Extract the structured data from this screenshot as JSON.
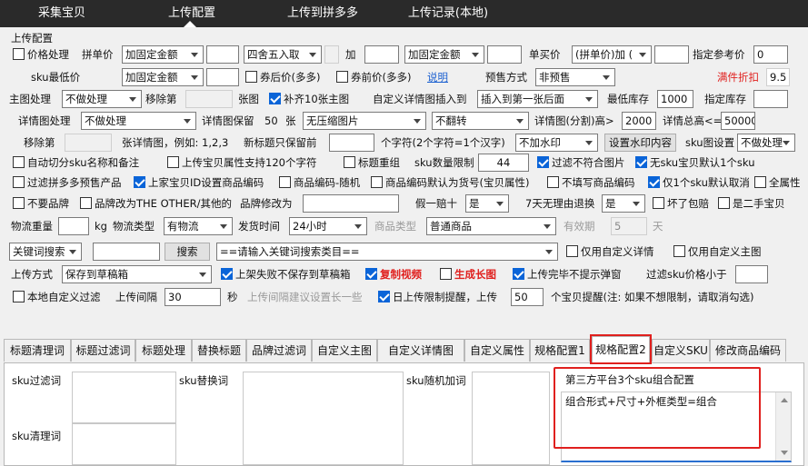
{
  "nav": {
    "tabs": [
      "采集宝贝",
      "上传配置",
      "上传到拼多多",
      "上传记录(本地)"
    ],
    "active_index": 1
  },
  "form": {
    "group_title": "上传配置",
    "r1": {
      "price_cb": "价格处理",
      "pin_label": "拼单价",
      "pin_sel": "加固定金额",
      "pin_amount": "",
      "pin_round_sel": "四舍五入取",
      "plus": "加",
      "pin_add": "",
      "single_sel": "加固定金额",
      "single_add": "",
      "buy_label": "单买价",
      "buy_sel": "(拼单价)加 (",
      "buy_add": "",
      "ref_label": "指定参考价",
      "ref_value": "0"
    },
    "r2": {
      "sku_min_label": "sku最低价",
      "sku_min_sel": "加固定金额",
      "sku_min_val": "",
      "after_coupon": "券后价(多多)",
      "before_coupon": "券前价(多多)",
      "explain": "说明",
      "presale_label": "预售方式",
      "presale_sel": "非预售",
      "discount_label": "满件折扣",
      "discount_value": "9.5"
    },
    "r3": {
      "main_img_label": "主图处理",
      "main_img_sel": "不做处理",
      "remove_label": "移除第",
      "remove_val": "",
      "img_unit": "张图",
      "fill10": "补齐10张主图",
      "custom_detail_label": "自定义详情图插入到",
      "custom_detail_sel": "插入到第一张后面",
      "min_stock_label": "最低库存",
      "min_stock": "1000",
      "spec_stock_label": "指定库存",
      "spec_stock": ""
    },
    "r4": {
      "detail_label": "详情图处理",
      "detail_sel": "不做处理",
      "keep_label": "详情图保留",
      "keep_value": "50",
      "keep_unit": "张",
      "compress_sel": "无压缩图片",
      "flip_sel": "不翻转",
      "split_label": "详情图(分割)高>",
      "split_value": "2000",
      "total_label": "详情总高<=",
      "total_value": "50000"
    },
    "r5": {
      "remove_label": "移除第",
      "remove_val": "",
      "remove_hint": "张详情图，例如: 1,2,3",
      "title_keep_label": "新标题只保留前",
      "title_keep_val": "",
      "title_keep_hint": "个字符(2个字符=1个汉字)",
      "watermark_sel": "不加水印",
      "watermark_btn": "设置水印内容",
      "skuimg_label": "sku图设置",
      "skuimg_sel": "不做处理"
    },
    "r6": {
      "auto_split": "自动切分sku名称和备注",
      "support120": "上传宝贝属性支持120个字符",
      "title_reorg": "标题重组",
      "sku_limit_label": "sku数量限制",
      "sku_limit_val": "44",
      "filter_img": "过滤不符合图片",
      "no_sku_default": "无sku宝贝默认1个sku"
    },
    "r7": {
      "filter_presale": "过滤拼多多预售产品",
      "upload_id": "上家宝贝ID设置商品编码",
      "code_random": "商品编码-随机",
      "code_default": "商品编码默认为货号(宝贝属性)",
      "no_code": "不填写商品编码",
      "one_sku_cancel": "仅1个sku默认取消",
      "all_attrs": "全属性"
    },
    "r8": {
      "no_brand": "不要品牌",
      "brand_other": "品牌改为THE OTHER/其他的",
      "brand_change_label": "品牌修改为",
      "brand_change_val": "",
      "fake_label": "假一赔十",
      "fake_sel": "是",
      "seven_label": "7天无理由退换",
      "seven_sel": "是",
      "broken": "坏了包赔",
      "second_hand": "是二手宝贝"
    },
    "r9": {
      "weight_label": "物流重量",
      "weight_val": "",
      "kg": "kg",
      "logistics_type_label": "物流类型",
      "logistics_type_sel": "有物流",
      "ship_time_label": "发货时间",
      "ship_time_sel": "24小时",
      "product_type_label": "商品类型",
      "product_type_sel": "普通商品",
      "validity_label": "有效期",
      "validity_val": "5",
      "validity_unit": "天"
    },
    "r10": {
      "kw_sel": "关键词搜索",
      "kw_input": "",
      "search_btn": "搜索",
      "category_sel": "==请输入关键词搜索类目==",
      "only_custom_detail": "仅用自定义详情",
      "only_custom_main": "仅用自定义主图"
    },
    "r11": {
      "upload_mode_label": "上传方式",
      "upload_mode_sel": "保存到草稿箱",
      "shelf_fail": "上架失败不保存到草稿箱",
      "copy_video": "复制视频",
      "gen_long": "生成长图",
      "no_popup": "上传完毕不提示弹窗",
      "filter_price_label": "过滤sku价格小于",
      "filter_price_val": ""
    },
    "r12": {
      "local_filter": "本地自定义过滤",
      "interval_label": "上传间隔",
      "interval_val": "30",
      "sec": "秒",
      "interval_hint": "上传间隔建议设置长一些",
      "daily_limit": "日上传限制提醒，上传",
      "daily_val": "50",
      "daily_hint": "个宝贝提醒(注: 如果不想限制，请取消勾选)"
    }
  },
  "tabs": [
    "标题清理词",
    "标题过滤词",
    "标题处理",
    "替换标题",
    "品牌过滤词",
    "自定义主图",
    "自定义详情图",
    "自定义属性",
    "规格配置1",
    "规格配置2",
    "自定义SKU",
    "修改商品编码"
  ],
  "active_tab": "规格配置2",
  "panel": {
    "sku_filter_label": "sku过滤词",
    "sku_clean_label": "sku清理词",
    "sku_replace_label": "sku替换词",
    "sku_random_label": "sku随机加词",
    "third_party_title": "第三方平台3个sku组合配置",
    "third_party_text": "组合形式+尺寸+外框类型=组合"
  },
  "colors": {
    "accent_red": "#e0201e",
    "checkbox_blue": "#0a64d8",
    "topbar": "#2a2a2a"
  }
}
